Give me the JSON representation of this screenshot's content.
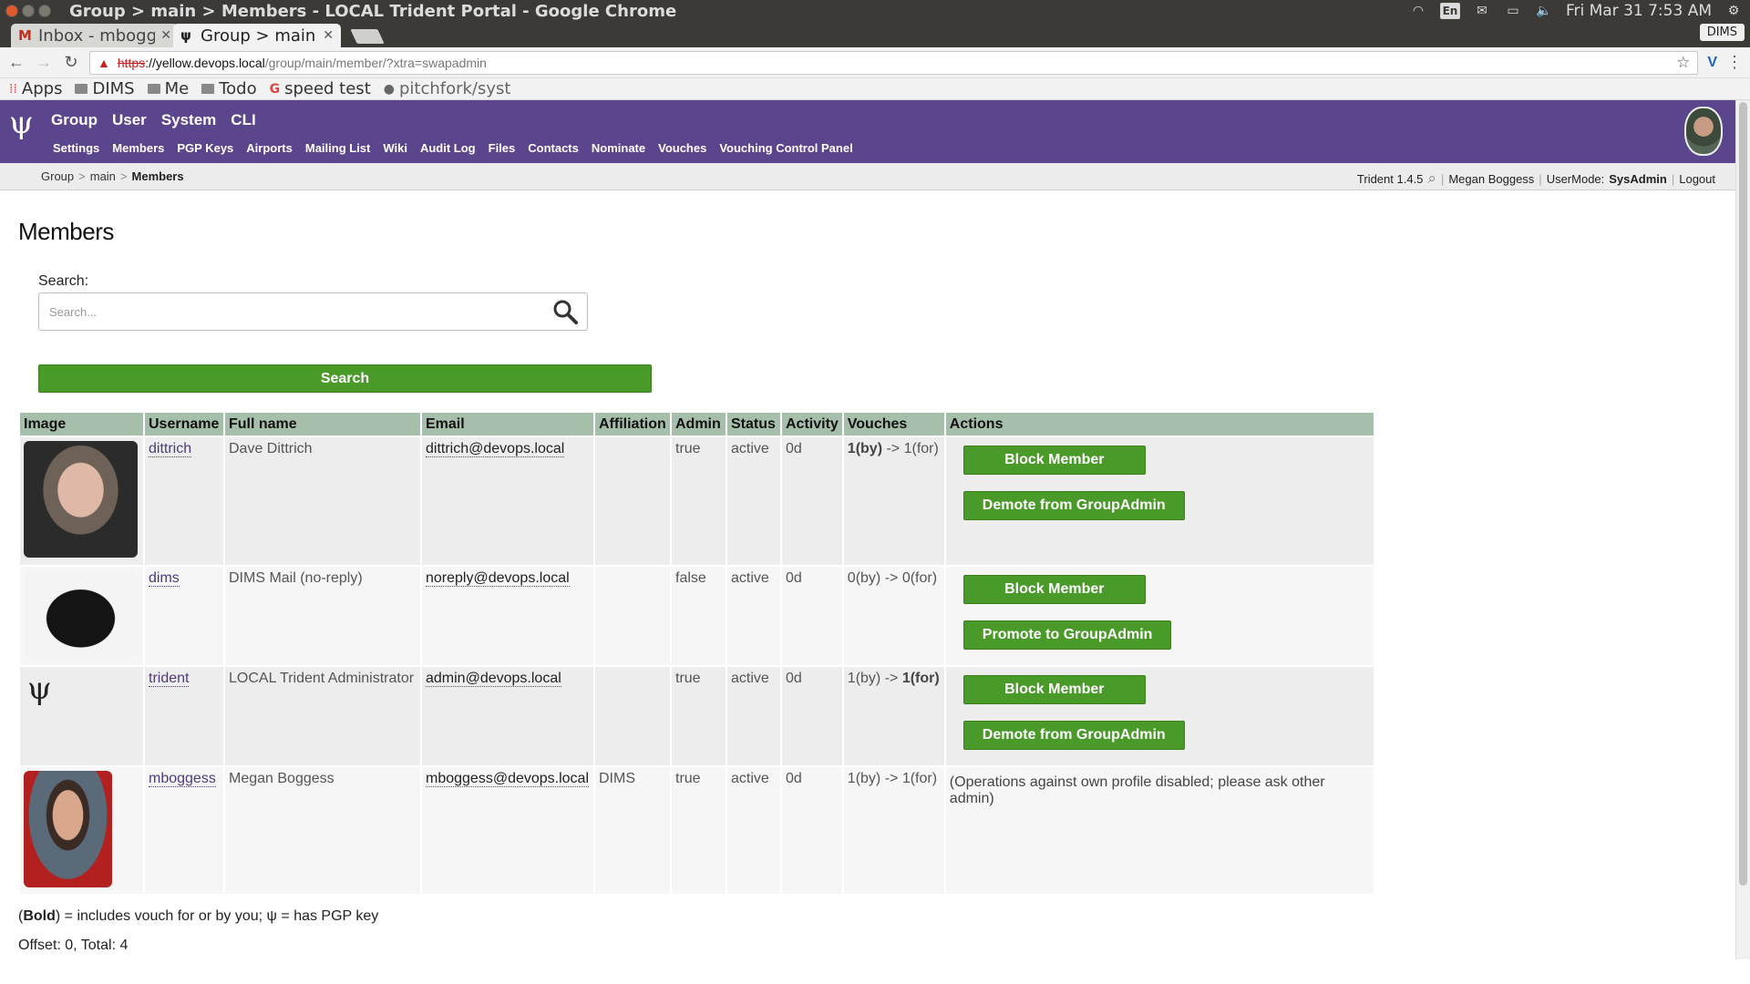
{
  "window": {
    "title": "Group > main > Members - LOCAL Trident Portal - Google Chrome",
    "clock": "Fri Mar 31  7:53 AM",
    "lang": "En"
  },
  "tabs": [
    {
      "label": "Inbox - mboggess",
      "icon": "M",
      "active": false
    },
    {
      "label": "Group > main > Members",
      "icon": "ψ",
      "active": true
    }
  ],
  "profile": "DIMS",
  "omnibox": {
    "scheme": "https",
    "host": "://yellow.devops.local",
    "path": "/group/main/member/?xtra=swapadmin"
  },
  "bookmarks": [
    {
      "label": "Apps",
      "icon": "apps"
    },
    {
      "label": "DIMS",
      "icon": "folder"
    },
    {
      "label": "Me",
      "icon": "folder"
    },
    {
      "label": "Todo",
      "icon": "folder"
    },
    {
      "label": "speed test",
      "icon": "google"
    },
    {
      "label": "pitchfork/syst",
      "icon": "github"
    }
  ],
  "nav": {
    "logo": "ψ",
    "primary": [
      "Group",
      "User",
      "System",
      "CLI"
    ],
    "secondary": [
      "Settings",
      "Members",
      "PGP Keys",
      "Airports",
      "Mailing List",
      "Wiki",
      "Audit Log",
      "Files",
      "Contacts",
      "Nominate",
      "Vouches",
      "Vouching Control Panel"
    ]
  },
  "breadcrumb": {
    "root": "Group",
    "mid": "main",
    "current": "Members"
  },
  "userbar": {
    "version": "Trident 1.4.5",
    "user": "Megan Boggess",
    "mode_label": "UserMode:",
    "mode_value": "SysAdmin",
    "logout": "Logout"
  },
  "main": {
    "title": "Members",
    "search_label": "Search:",
    "search_placeholder": "Search...",
    "search_button": "Search"
  },
  "table": {
    "headers": [
      "Image",
      "Username",
      "Full name",
      "Email",
      "Affiliation",
      "Admin",
      "Status",
      "Activity",
      "Vouches",
      "Actions"
    ],
    "rows": [
      {
        "avatar": "dave",
        "username": "dittrich",
        "fullname": "Dave Dittrich",
        "email": "dittrich@devops.local",
        "affiliation": "",
        "admin": "true",
        "status": "active",
        "activity": "0d",
        "vouch_by": "1(by)",
        "vouch_sep": " -> ",
        "vouch_for": "1(for)",
        "vouch_bold": "by",
        "actions": [
          "Block Member",
          "Demote from GroupAdmin"
        ],
        "note": ""
      },
      {
        "avatar": "dims",
        "username": "dims",
        "fullname": "DIMS Mail (no-reply)",
        "email": "noreply@devops.local",
        "affiliation": "",
        "admin": "false",
        "status": "active",
        "activity": "0d",
        "vouch_by": "0(by)",
        "vouch_sep": " -> ",
        "vouch_for": "0(for)",
        "vouch_bold": "",
        "actions": [
          "Block Member",
          "Promote to GroupAdmin"
        ],
        "note": ""
      },
      {
        "avatar": "trident",
        "username": "trident",
        "fullname": "LOCAL Trident Administrator",
        "email": "admin@devops.local",
        "affiliation": "",
        "admin": "true",
        "status": "active",
        "activity": "0d",
        "vouch_by": "1(by)",
        "vouch_sep": " -> ",
        "vouch_for": "1(for)",
        "vouch_bold": "for",
        "actions": [
          "Block Member",
          "Demote from GroupAdmin"
        ],
        "note": ""
      },
      {
        "avatar": "megan",
        "username": "mboggess",
        "fullname": "Megan Boggess",
        "email": "mboggess@devops.local",
        "affiliation": "DIMS",
        "admin": "true",
        "status": "active",
        "activity": "0d",
        "vouch_by": "1(by)",
        "vouch_sep": " -> ",
        "vouch_for": "1(for)",
        "vouch_bold": "",
        "actions": [],
        "note": "(Operations against own profile disabled; please ask other admin)"
      }
    ]
  },
  "legend": {
    "open": "(",
    "bold": "Bold",
    "rest": ") = includes vouch for or by you; ψ = has PGP key"
  },
  "offset_text": "Offset: 0, Total: 4",
  "colors": {
    "nav_bg": "#5b468d",
    "button_green": "#4a9a2a",
    "table_header": "#a6bfaa"
  }
}
